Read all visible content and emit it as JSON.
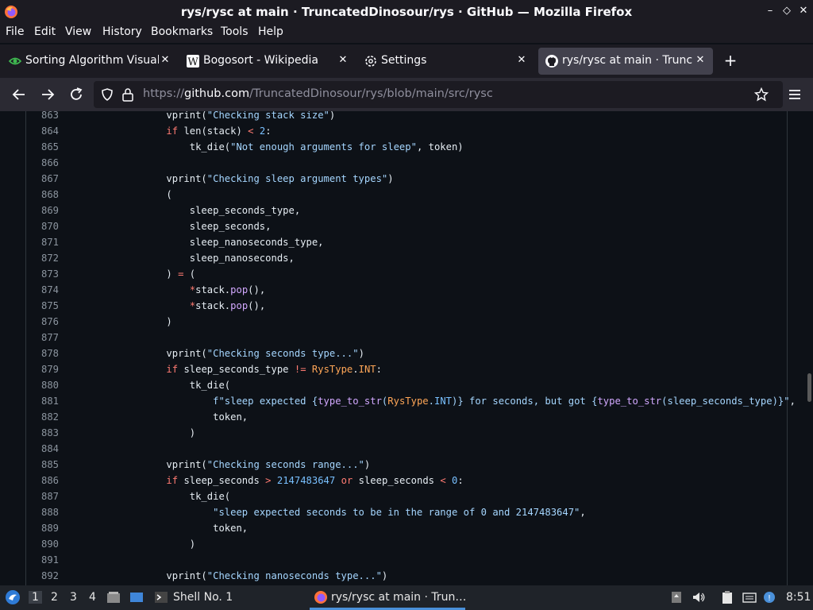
{
  "window": {
    "title": "rys/rysc at main · TruncatedDinosour/rys · GitHub — Mozilla Firefox",
    "minimize": "–",
    "maximize": "◇",
    "close": "✕"
  },
  "menubar": {
    "items": [
      "File",
      "Edit",
      "View",
      "History",
      "Bookmarks",
      "Tools",
      "Help"
    ]
  },
  "tabs": [
    {
      "label": "Sorting Algorithm Visuali",
      "icon": "sorting-visualizer-icon",
      "close": "✕"
    },
    {
      "label": "Bogosort - Wikipedia",
      "icon": "wikipedia-icon",
      "close": "✕"
    },
    {
      "label": "Settings",
      "icon": "gear-icon",
      "close": "✕"
    },
    {
      "label": "rys/rysc at main · Truncat",
      "icon": "github-icon",
      "close": "✕",
      "active": true
    }
  ],
  "newtab": "+",
  "nav": {
    "url_prefix": "https://",
    "url_host": "github.com",
    "url_path": "/TruncatedDinosour/rys/blob/main/src/rysc"
  },
  "code": {
    "lines": [
      {
        "n": "863",
        "parts": [
          [
            "",
            "    vprint("
          ],
          [
            "s",
            "\"Checking stack size\""
          ],
          [
            "",
            ")"
          ]
        ]
      },
      {
        "n": "864",
        "parts": [
          [
            "k",
            "    if "
          ],
          [
            "",
            "len(stack) "
          ],
          [
            "k",
            "<"
          ],
          [
            "",
            " "
          ],
          [
            "c",
            "2"
          ],
          [
            "",
            ":"
          ]
        ]
      },
      {
        "n": "865",
        "parts": [
          [
            "",
            "        tk_die("
          ],
          [
            "s",
            "\"Not enough arguments for sleep\""
          ],
          [
            "",
            ", token)"
          ]
        ]
      },
      {
        "n": "866",
        "parts": []
      },
      {
        "n": "867",
        "parts": [
          [
            "",
            "    vprint("
          ],
          [
            "s",
            "\"Checking sleep argument types\""
          ],
          [
            "",
            ")"
          ]
        ]
      },
      {
        "n": "868",
        "parts": [
          [
            "",
            "    ("
          ]
        ]
      },
      {
        "n": "869",
        "parts": [
          [
            "",
            "        sleep_seconds_type,"
          ]
        ]
      },
      {
        "n": "870",
        "parts": [
          [
            "",
            "        sleep_seconds,"
          ]
        ]
      },
      {
        "n": "871",
        "parts": [
          [
            "",
            "        sleep_nanoseconds_type,"
          ]
        ]
      },
      {
        "n": "872",
        "parts": [
          [
            "",
            "        sleep_nanoseconds,"
          ]
        ]
      },
      {
        "n": "873",
        "parts": [
          [
            "",
            "    ) "
          ],
          [
            "k",
            "="
          ],
          [
            "",
            " ("
          ]
        ]
      },
      {
        "n": "874",
        "parts": [
          [
            "",
            "        "
          ],
          [
            "k",
            "*"
          ],
          [
            "",
            "stack."
          ],
          [
            "f",
            "pop"
          ],
          [
            "",
            "(),"
          ]
        ]
      },
      {
        "n": "875",
        "parts": [
          [
            "",
            "        "
          ],
          [
            "k",
            "*"
          ],
          [
            "",
            "stack."
          ],
          [
            "f",
            "pop"
          ],
          [
            "",
            "(),"
          ]
        ]
      },
      {
        "n": "876",
        "parts": [
          [
            "",
            "    )"
          ]
        ]
      },
      {
        "n": "877",
        "parts": []
      },
      {
        "n": "878",
        "parts": [
          [
            "",
            "    vprint("
          ],
          [
            "s",
            "\"Checking seconds type...\""
          ],
          [
            "",
            ")"
          ]
        ]
      },
      {
        "n": "879",
        "parts": [
          [
            "k",
            "    if "
          ],
          [
            "",
            "sleep_seconds_type "
          ],
          [
            "k",
            "!="
          ],
          [
            "",
            " "
          ],
          [
            "o",
            "RysType"
          ],
          [
            "",
            "."
          ],
          [
            "o",
            "INT"
          ],
          [
            "",
            ":"
          ]
        ]
      },
      {
        "n": "880",
        "parts": [
          [
            "",
            "        tk_die("
          ]
        ]
      },
      {
        "n": "881",
        "parts": [
          [
            "",
            "            "
          ],
          [
            "s",
            "f\"sleep expected {"
          ],
          [
            "f",
            "type_to_str"
          ],
          [
            "s",
            "("
          ],
          [
            "o",
            "RysType"
          ],
          [
            "s",
            "."
          ],
          [
            "c",
            "INT"
          ],
          [
            "s",
            ")} for seconds, but got {"
          ],
          [
            "f",
            "type_to_str"
          ],
          [
            "s",
            "(sleep_seconds_type)}\""
          ],
          [
            "",
            ","
          ]
        ]
      },
      {
        "n": "882",
        "parts": [
          [
            "",
            "            token,"
          ]
        ]
      },
      {
        "n": "883",
        "parts": [
          [
            "",
            "        )"
          ]
        ]
      },
      {
        "n": "884",
        "parts": []
      },
      {
        "n": "885",
        "parts": [
          [
            "",
            "    vprint("
          ],
          [
            "s",
            "\"Checking seconds range...\""
          ],
          [
            "",
            ")"
          ]
        ]
      },
      {
        "n": "886",
        "parts": [
          [
            "k",
            "    if "
          ],
          [
            "",
            "sleep_seconds "
          ],
          [
            "k",
            ">"
          ],
          [
            "",
            " "
          ],
          [
            "c",
            "2147483647"
          ],
          [
            "",
            " "
          ],
          [
            "k",
            "or"
          ],
          [
            "",
            " sleep_seconds "
          ],
          [
            "k",
            "<"
          ],
          [
            "",
            " "
          ],
          [
            "c",
            "0"
          ],
          [
            "",
            ":"
          ]
        ]
      },
      {
        "n": "887",
        "parts": [
          [
            "",
            "        tk_die("
          ]
        ]
      },
      {
        "n": "888",
        "parts": [
          [
            "",
            "            "
          ],
          [
            "s",
            "\"sleep expected seconds to be in the range of 0 and 2147483647\""
          ],
          [
            "",
            ","
          ]
        ]
      },
      {
        "n": "889",
        "parts": [
          [
            "",
            "            token,"
          ]
        ]
      },
      {
        "n": "890",
        "parts": [
          [
            "",
            "        )"
          ]
        ]
      },
      {
        "n": "891",
        "parts": []
      },
      {
        "n": "892",
        "parts": [
          [
            "",
            "    vprint("
          ],
          [
            "s",
            "\"Checking nanoseconds type...\""
          ],
          [
            "",
            ")"
          ]
        ]
      }
    ]
  },
  "taskbar": {
    "workspaces": [
      "1",
      "2",
      "3",
      "4"
    ],
    "shell_label": "Shell No. 1",
    "firefox_label": "rys/rysc at main · Trun…",
    "clock": "8:51"
  },
  "colors": {
    "background": "#0d1117",
    "keyword": "#ff7b72",
    "string": "#a5d6ff",
    "function": "#d2a8ff",
    "constant": "#79c0ff",
    "class": "#ffa657"
  }
}
